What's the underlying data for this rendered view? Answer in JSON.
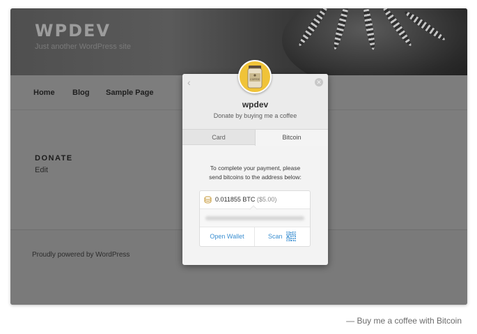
{
  "site": {
    "title": "WPDEV",
    "tagline": "Just another WordPress site"
  },
  "nav": {
    "items": [
      "Home",
      "Blog",
      "Sample Page"
    ]
  },
  "page": {
    "entry_title": "DONATE",
    "edit_label": "Edit"
  },
  "footer": {
    "text": "Proudly powered by WordPress"
  },
  "modal": {
    "name": "wpdev",
    "description": "Donate by buying me a coffee",
    "logo_text": "COFFEE",
    "tabs": [
      {
        "label": "Card",
        "active": false
      },
      {
        "label": "Bitcoin",
        "active": true
      }
    ],
    "instructions_line1": "To complete your payment, please",
    "instructions_line2": "send bitcoins to the address below:",
    "amount_btc": "0.011855 BTC",
    "amount_usd": "($5.00)",
    "open_wallet_label": "Open Wallet",
    "scan_label": "Scan",
    "icons": {
      "back": "chevron-left-icon",
      "close": "close-icon",
      "coin": "coin-stack-icon",
      "qr": "qr-code-icon"
    }
  },
  "caption": "— Buy me a coffee with Bitcoin",
  "colors": {
    "link": "#3b8fd1",
    "overlay": "#7d7d7d",
    "logo_bg": "#f0c338"
  }
}
